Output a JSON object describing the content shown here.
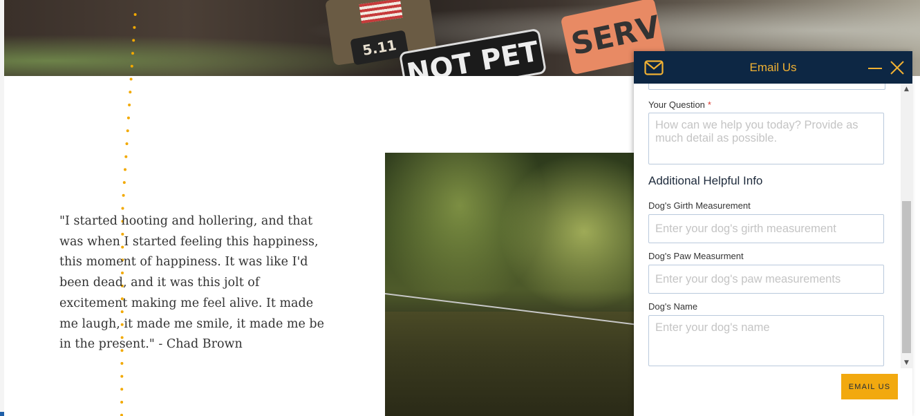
{
  "hero": {
    "patch_text": "5.11",
    "badge_text": "NOT PET",
    "service_text": "SERV"
  },
  "quote": {
    "text": "\"I started hooting and hollering, and that was when I started feeling this happiness, this moment of happiness. It was like I'd been dead, and it was this jolt of excitement making me feel alive. It made me laugh, it made me smile, it made me be in the present.\" - Chad Brown"
  },
  "email_panel": {
    "title": "Email Us",
    "icons": [
      "mail-icon",
      "minimize-icon",
      "close-icon"
    ],
    "question_label": "Your Question",
    "required_mark": "*",
    "question_placeholder": "How can we help you today? Provide as much detail as possible.",
    "section_title": "Additional Helpful Info",
    "girth_label": "Dog's Girth Measurement",
    "girth_placeholder": "Enter your dog's girth measurement",
    "paw_label": "Dog's Paw Measurment",
    "paw_placeholder": "Enter your dog's paw measurements",
    "name_label": "Dog's Name",
    "name_placeholder": "Enter your dog's name",
    "submit_label": "EMAIL US"
  },
  "colors": {
    "header_bg": "#0d2744",
    "accent": "#f2b233",
    "button": "#f2a90f",
    "dots": "#f2a900"
  }
}
